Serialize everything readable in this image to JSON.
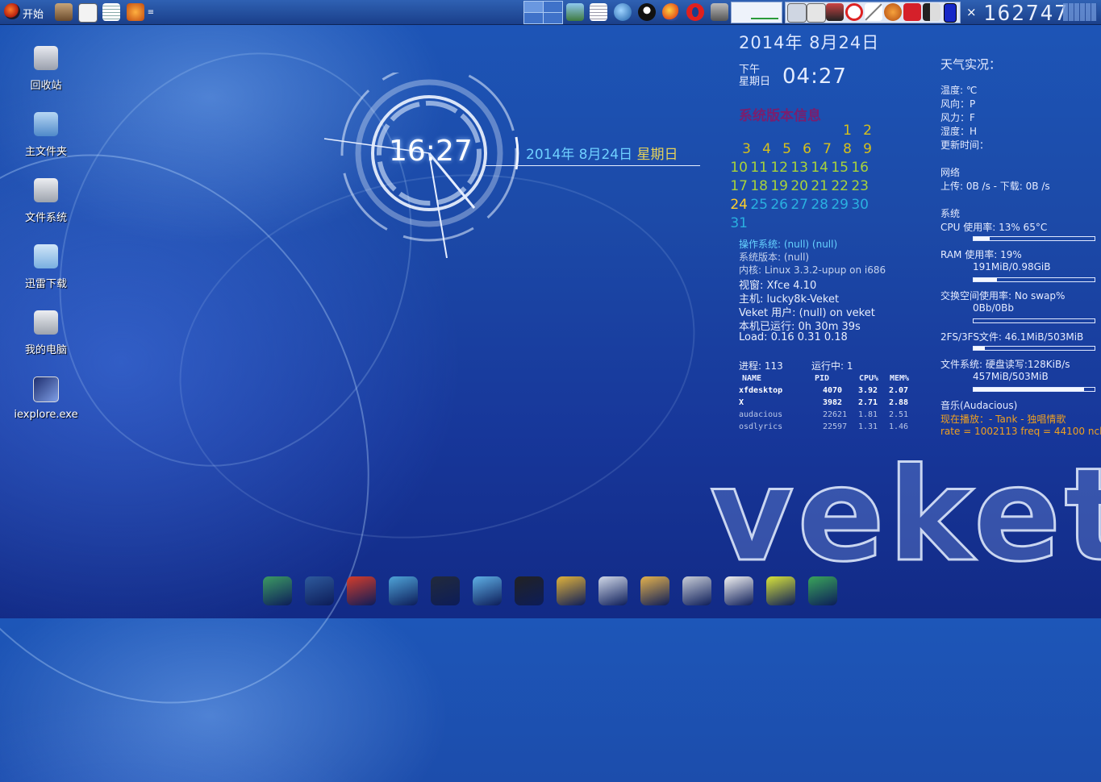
{
  "taskbar": {
    "start_label": "开始",
    "menu_glyph": "≡",
    "close_glyph": "×",
    "big_clock": "162747",
    "launchers": [
      "hammer-icon",
      "tux-face-icon",
      "text-editor-icon",
      "paint-icon"
    ],
    "tray_apps": [
      "photo-viewer-icon",
      "notepad-icon",
      "earth-icon",
      "qq-penguin-icon",
      "firefox-icon",
      "opera-icon",
      "game-icon"
    ],
    "tray_system": [
      "calculator-icon",
      "clipboard-icon",
      "media-icon",
      "no-entry-icon",
      "pen-icon",
      "paint-palette-icon",
      "flash-icon",
      "volume-icon",
      "battery-icon"
    ]
  },
  "desktop_icons": [
    {
      "label": "回收站",
      "icon": "recycle-bin-icon",
      "color": "#c7ccd6"
    },
    {
      "label": "主文件夹",
      "icon": "home-folder-icon",
      "color": "#7fb5e4"
    },
    {
      "label": "文件系统",
      "icon": "drive-icon",
      "color": "#c9cdd4"
    },
    {
      "label": "迅雷下载",
      "icon": "folder-icon",
      "color": "#9fcbef"
    },
    {
      "label": "我的电脑",
      "icon": "computer-icon",
      "color": "#c9cdd4"
    },
    {
      "label": "iexplore.exe",
      "icon": "exe-icon",
      "color": "#5a6fb8"
    }
  ],
  "clock_widget": {
    "time": "16:27",
    "date": "2014年 8月24日",
    "weekday": "星期日"
  },
  "conky_left": {
    "date": "2014年 8月24日",
    "ampm": "下午",
    "weekday": "星期日",
    "time": "04:27",
    "section_title": "系统版本信息",
    "calendar": {
      "today": "24",
      "rows": [
        [
          "",
          "",
          "",
          "",
          "",
          "1",
          "2"
        ],
        [
          "3",
          "4",
          "5",
          "6",
          "7",
          "8",
          "9"
        ],
        [
          "10",
          "11",
          "12",
          "13",
          "14",
          "15",
          "16"
        ],
        [
          "17",
          "18",
          "19",
          "20",
          "21",
          "22",
          "23"
        ],
        [
          "24",
          "25",
          "26",
          "27",
          "28",
          "29",
          "30"
        ],
        [
          "31",
          "",
          "",
          "",
          "",
          "",
          ""
        ]
      ]
    },
    "os": "操作系统: (null) (null)",
    "sysver": "系统版本: (null)",
    "kernel": "内核: Linux 3.3.2-upup on i686",
    "wm": "视窗:  Xfce 4.10",
    "host": "主机:  lucky8k-Veket",
    "user": "Veket 用户: (null) on  veket",
    "uptime": "本机已运行: 0h 30m 39s",
    "load": "Load: 0.16 0.31 0.18",
    "proc_count": "进程: 113",
    "running": "运行中: 1",
    "proc_headers": [
      "NAME",
      "PID",
      "CPU%",
      "MEM%"
    ],
    "procs": [
      {
        "name": "xfdesktop",
        "pid": "4070",
        "cpu": "3.92",
        "mem": "2.07"
      },
      {
        "name": "X",
        "pid": "3982",
        "cpu": "2.71",
        "mem": "2.88"
      },
      {
        "name": "audacious",
        "pid": "22621",
        "cpu": "1.81",
        "mem": "2.51"
      },
      {
        "name": "osdlyrics",
        "pid": "22597",
        "cpu": "1.31",
        "mem": "1.46"
      }
    ]
  },
  "conky_right": {
    "weather_title": "天气实况：",
    "temp": "温度:  ℃",
    "wind_dir": "风向：P",
    "wind_force": "风力：F",
    "humidity": "湿度：H",
    "updated": "更新时间：",
    "net_title": "网络",
    "net": "上传: 0B /s - 下载: 0B /s",
    "sys_title": "系统",
    "cpu": "CPU 使用率: 13%     65°C",
    "cpu_level": 0.13,
    "ram": "RAM 使用率: 19%",
    "ram_detail": "191MiB/0.98GiB",
    "ram_level": 0.19,
    "swap": "交换空间使用率: No swap%",
    "swap_detail": "0Bb/0Bb",
    "swap_level": 0,
    "fs2": "2FS/3FS文件: 46.1MiB/503MiB",
    "fs2_level": 0.09,
    "fs": "文件系统:     硬盘读写:128KiB/s",
    "fs_detail": "457MiB/503MiB",
    "fs_level": 0.91,
    "music": "音乐(Audacious)",
    "now_playing": "现在播放：- Tank - 独唱情歌",
    "rate": "rate = 1002113 freq = 44100 ncl"
  },
  "logo_text": "veket",
  "dock": [
    "file-manager-icon",
    "monitor-icon",
    "pet-icon",
    "drawing-icon",
    "media-player-icon",
    "users-icon",
    "qq-penguin-icon",
    "door-exit-icon",
    "presentation-icon",
    "palette-icon",
    "usb-drive-icon",
    "calendar-icon",
    "help-icon",
    "camera-icon"
  ]
}
